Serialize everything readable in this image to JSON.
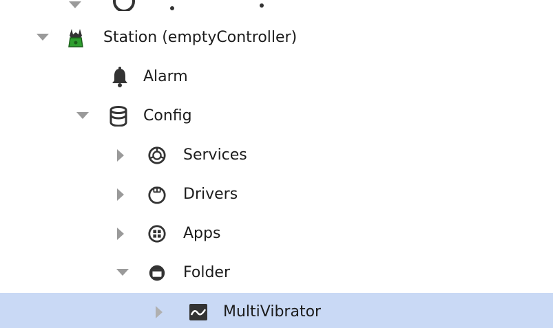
{
  "tree": {
    "nodes": [
      {
        "label": "Station (emptyController)",
        "icon": "station-icon",
        "state": "expanded"
      },
      {
        "label": "Alarm",
        "icon": "alarm-bell-icon",
        "state": "leaf"
      },
      {
        "label": "Config",
        "icon": "database-icon",
        "state": "expanded"
      },
      {
        "label": "Services",
        "icon": "services-icon",
        "state": "collapsed"
      },
      {
        "label": "Drivers",
        "icon": "drivers-icon",
        "state": "collapsed"
      },
      {
        "label": "Apps",
        "icon": "apps-icon",
        "state": "collapsed"
      },
      {
        "label": "Folder",
        "icon": "folder-icon",
        "state": "expanded"
      },
      {
        "label": "MultiVibrator",
        "icon": "multivibrator-icon",
        "state": "collapsed",
        "selected": true
      }
    ]
  },
  "colors": {
    "selection": "#c9d9f5",
    "caret": "#9a9a9a",
    "icon": "#333333",
    "station_green": "#2e9e2e"
  }
}
